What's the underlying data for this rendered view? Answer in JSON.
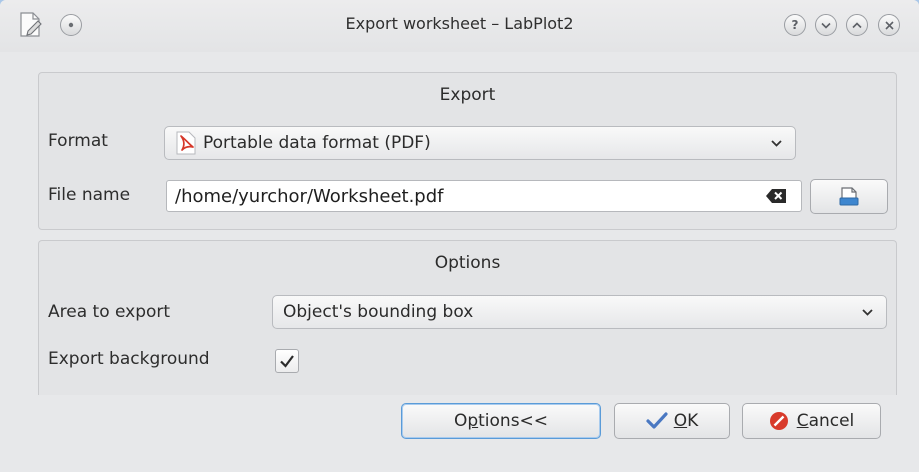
{
  "window": {
    "title": "Export worksheet – LabPlot2",
    "help_glyph": "?"
  },
  "export_group": {
    "title": "Export",
    "format_label": "Format",
    "format_value": "Portable data format (PDF)",
    "format_icon": "pdf-icon",
    "filename_label": "File name",
    "filename_value": "/home/yurchor/Worksheet.pdf"
  },
  "options_group": {
    "title": "Options",
    "area_label": "Area to export",
    "area_value": "Object's bounding box",
    "background_label": "Export background",
    "background_checked": true
  },
  "buttons": {
    "options": {
      "pre": "O",
      "mnemonic": "p",
      "post": "tions<<"
    },
    "ok": {
      "pre": "",
      "mnemonic": "O",
      "post": "K"
    },
    "cancel": {
      "pre": "",
      "mnemonic": "C",
      "post": "ancel"
    }
  },
  "colors": {
    "accent_focus": "#5a9bd8",
    "ok_icon": "#4a78c2",
    "cancel_icon": "#d83a2b",
    "pdf_icon": "#d6382a"
  }
}
